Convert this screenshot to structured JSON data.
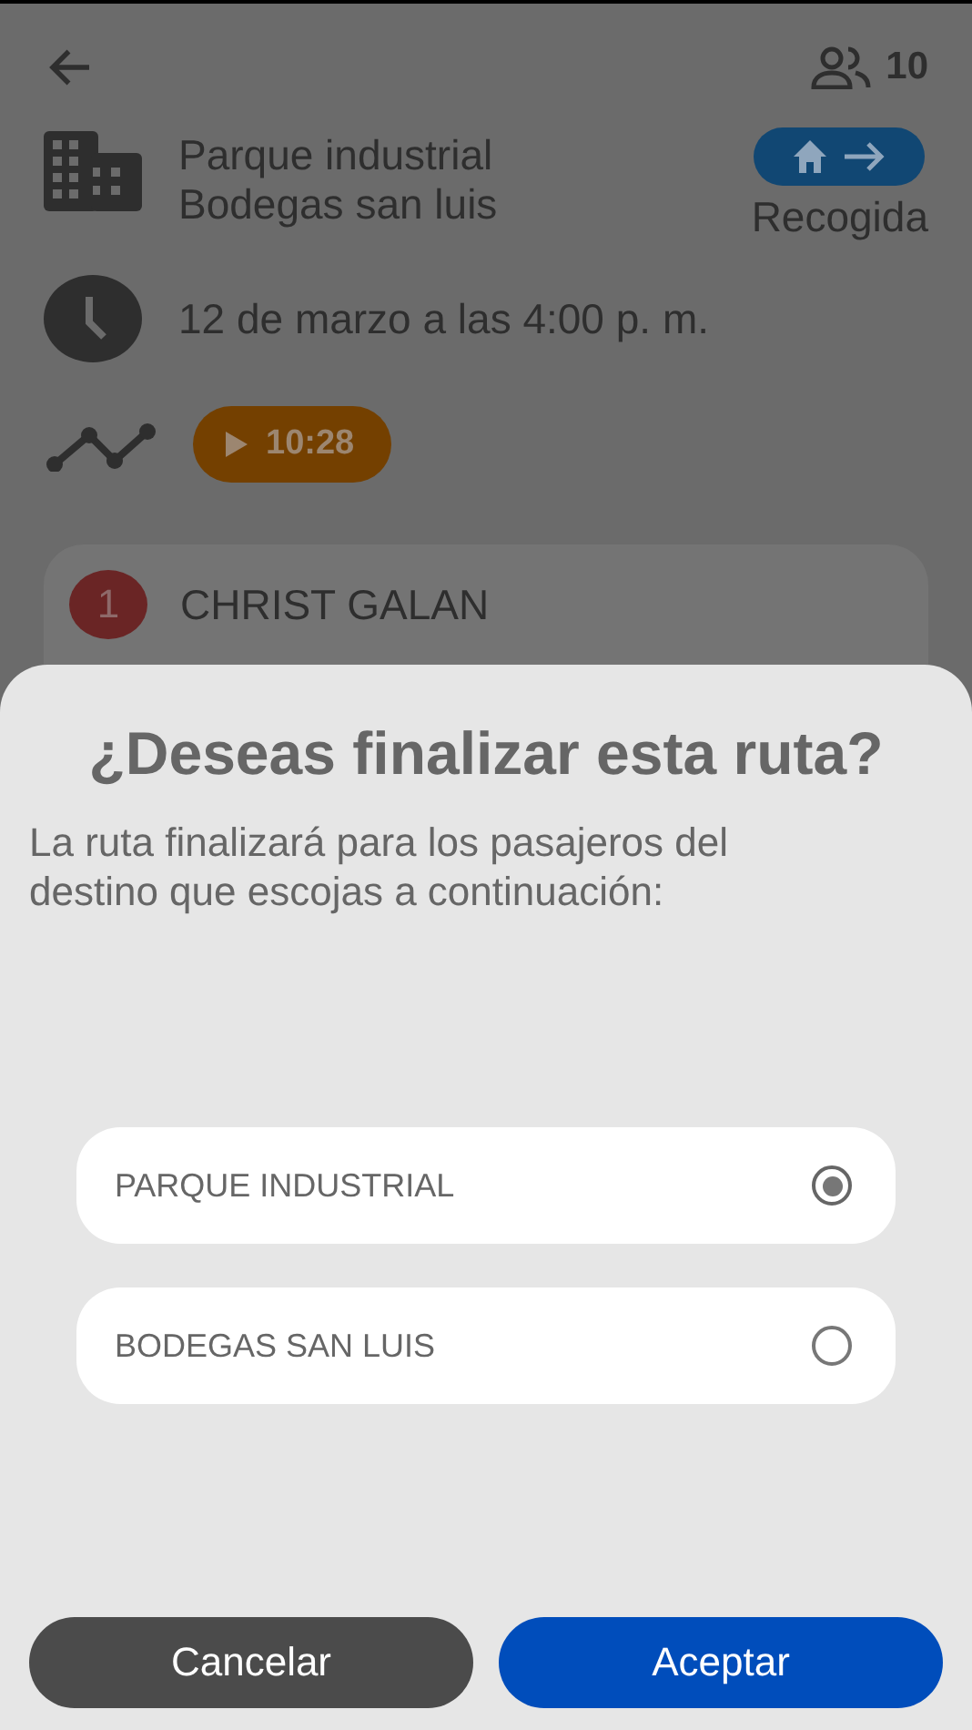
{
  "header": {
    "passenger_count": "10"
  },
  "trip": {
    "destinations": [
      "Parque industrial",
      "Bodegas san luis"
    ],
    "mode_label": "Recogida",
    "datetime": "12 de marzo a las 4:00 p. m.",
    "timer": "10:28"
  },
  "passengers": [
    {
      "number": "1",
      "name": "CHRIST GALAN"
    }
  ],
  "dialog": {
    "title": "¿Deseas finalizar esta ruta?",
    "message": "La ruta finalizará para los pasajeros del destino que escojas a continuación:",
    "options": [
      {
        "label": "PARQUE INDUSTRIAL",
        "selected": true
      },
      {
        "label": "BODEGAS SAN LUIS",
        "selected": false
      }
    ],
    "buttons": [
      {
        "label": "Cancelar",
        "kind": "secondary"
      },
      {
        "label": "Aceptar",
        "kind": "primary"
      }
    ]
  }
}
